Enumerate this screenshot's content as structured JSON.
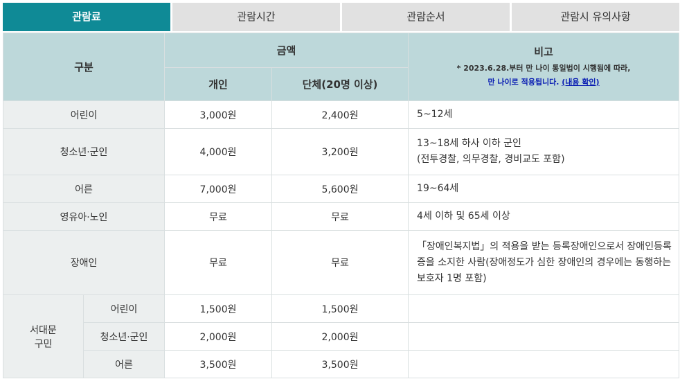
{
  "tabs": [
    {
      "label": "관람료",
      "active": true
    },
    {
      "label": "관람시간",
      "active": false
    },
    {
      "label": "관람순서",
      "active": false
    },
    {
      "label": "관람시 유의사항",
      "active": false
    }
  ],
  "header": {
    "category": "구분",
    "amount": "금액",
    "individual": "개인",
    "group": "단체(20명 이상)",
    "remarks": "비고",
    "remarks_note1": "* 2023.6.28.부터 만 나이 통일법이 시행됨에 따라,",
    "remarks_note2": "만 나이로 적용됩니다.",
    "remarks_link": "(내용 확인)"
  },
  "rows": [
    {
      "label": "어린이",
      "individual": "3,000원",
      "group": "2,400원",
      "note": "5~12세"
    },
    {
      "label": "청소년·군인",
      "individual": "4,000원",
      "group": "3,200원",
      "note": "13~18세 하사 이하 군인",
      "note2": "(전투경찰, 의무경찰, 경비교도 포함)"
    },
    {
      "label": "어른",
      "individual": "7,000원",
      "group": "5,600원",
      "note": "19~64세"
    },
    {
      "label": "영유아·노인",
      "individual": "무료",
      "group": "무료",
      "note": "4세 이하 및 65세 이상"
    },
    {
      "label": "장애인",
      "individual": "무료",
      "group": "무료",
      "note": "「장애인복지법」의 적용을 받는 등록장애인으로서 장애인등록증을 소지한 사람(장애정도가 심한 장애인의 경우에는 동행하는 보호자 1명 포함)"
    }
  ],
  "resident": {
    "label_line1": "서대문",
    "label_line2": "구민",
    "rows": [
      {
        "label": "어린이",
        "individual": "1,500원",
        "group": "1,500원"
      },
      {
        "label": "청소년·군인",
        "individual": "2,000원",
        "group": "2,000원"
      },
      {
        "label": "어른",
        "individual": "3,500원",
        "group": "3,500원"
      }
    ]
  }
}
